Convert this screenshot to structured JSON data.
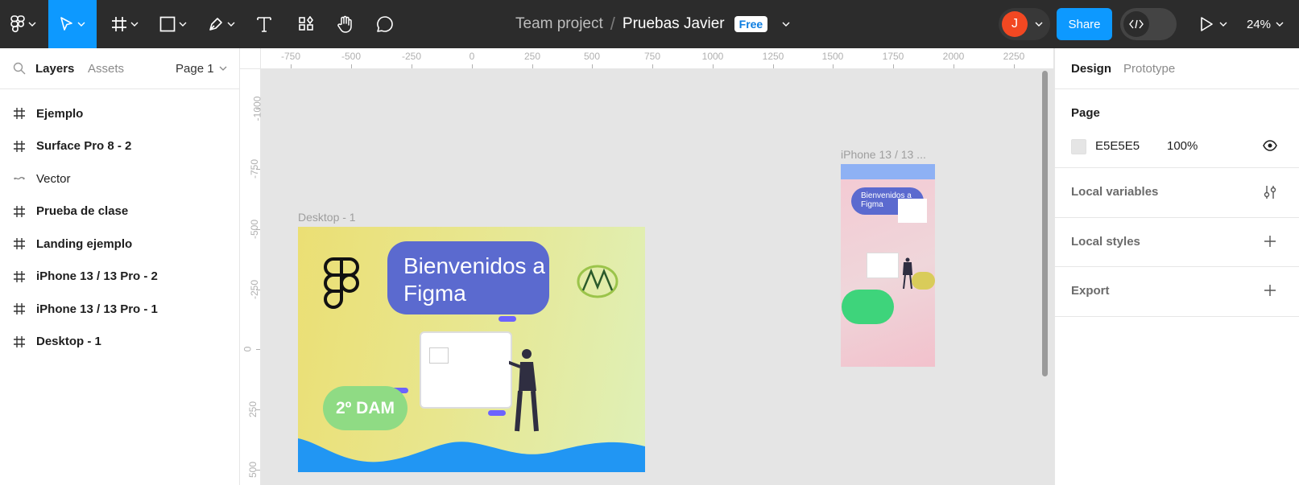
{
  "toolbar": {
    "breadcrumb_team": "Team project",
    "breadcrumb_separator": "/",
    "file_name": "Pruebas Javier",
    "plan_badge": "Free",
    "avatar_initial": "J",
    "share_label": "Share",
    "zoom_level": "24%",
    "brand_color": "#0d99ff"
  },
  "left_panel": {
    "tabs": {
      "layers": "Layers",
      "assets": "Assets"
    },
    "page_selector": "Page 1",
    "layers": [
      {
        "icon": "frame-icon",
        "label": "Ejemplo"
      },
      {
        "icon": "frame-icon",
        "label": "Surface Pro 8 - 2"
      },
      {
        "icon": "vector-icon",
        "label": "Vector"
      },
      {
        "icon": "frame-icon",
        "label": "Prueba de clase"
      },
      {
        "icon": "frame-icon",
        "label": "Landing ejemplo"
      },
      {
        "icon": "frame-icon",
        "label": "iPhone 13 / 13 Pro - 2"
      },
      {
        "icon": "frame-icon",
        "label": "iPhone 13 / 13 Pro - 1"
      },
      {
        "icon": "frame-icon",
        "label": "Desktop - 1"
      }
    ]
  },
  "rulers": {
    "horizontal": [
      "-750",
      "-500",
      "-250",
      "0",
      "250",
      "500",
      "750",
      "1000",
      "1250",
      "1500",
      "1750",
      "2000",
      "2250"
    ],
    "vertical": [
      "-1000",
      "-750",
      "-500",
      "-250",
      "0",
      "250",
      "500"
    ]
  },
  "canvas": {
    "desktop_frame": {
      "name": "Desktop - 1",
      "welcome_text": "Bienvenidos a Figma",
      "badge_text": "2º DAM"
    },
    "iphone_frame": {
      "name": "iPhone 13 / 13 ...",
      "welcome_text": "Bienvenidos a Figma"
    }
  },
  "right_panel": {
    "tabs": {
      "design": "Design",
      "prototype": "Prototype"
    },
    "page_section": {
      "title": "Page",
      "color_hex": "E5E5E5",
      "opacity": "100%",
      "swatch_color": "#e5e5e5"
    },
    "sections": [
      {
        "title": "Local variables",
        "icon": "sliders-icon"
      },
      {
        "title": "Local styles",
        "icon": "plus-icon"
      },
      {
        "title": "Export",
        "icon": "plus-icon"
      }
    ]
  }
}
